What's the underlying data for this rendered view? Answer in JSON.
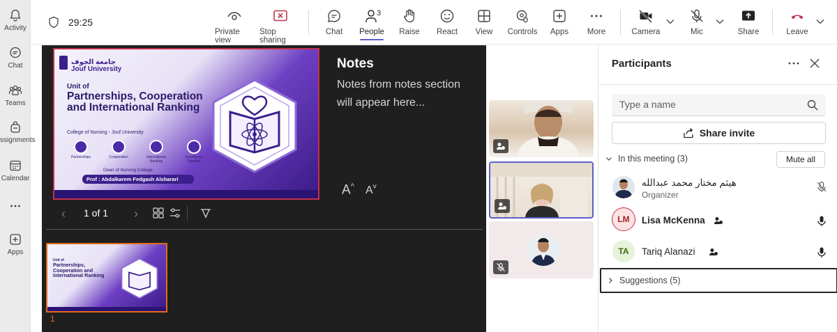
{
  "rail": {
    "items": [
      {
        "label": "Activity",
        "icon": "bell-icon"
      },
      {
        "label": "Chat",
        "icon": "chat-icon"
      },
      {
        "label": "Teams",
        "icon": "teams-icon"
      },
      {
        "label": "Assignments",
        "icon": "backpack-icon"
      },
      {
        "label": "Calendar",
        "icon": "calendar-icon"
      },
      {
        "label": "",
        "icon": "more-icon"
      },
      {
        "label": "Apps",
        "icon": "add-app-icon"
      }
    ]
  },
  "toolbar": {
    "timer": "29:25",
    "private_view": "Private view",
    "stop_sharing": "Stop sharing",
    "chat": "Chat",
    "people": "People",
    "people_count": "3",
    "raise": "Raise",
    "react": "React",
    "view": "View",
    "controls": "Controls",
    "apps": "Apps",
    "more": "More",
    "camera": "Camera",
    "mic": "Mic",
    "share": "Share",
    "leave": "Leave",
    "accent_color": "#5b5fc7",
    "alert_color": "#c4314b"
  },
  "stage": {
    "notes_title": "Notes",
    "notes_body": "Notes from notes section will appear here...",
    "font_increase": "A",
    "font_decrease": "A",
    "slide_count": "1 of 1",
    "thumb_number": "1",
    "slide": {
      "logo_text": "جامعة الجوف\nJouf University",
      "unit": "Unit of",
      "heading": "Partnerships, Cooperation and International Ranking",
      "college": "College of Nursing - Jouf University",
      "icons": [
        "Partnerships",
        "Cooperation",
        "International Ranking",
        "Excellence Together"
      ],
      "dean": "Dean of Nursing College",
      "prof": "Prof : Abdalkarem Fedgash Alsharari"
    }
  },
  "panel": {
    "title": "Participants",
    "search_placeholder": "Type a name",
    "share_invite": "Share invite",
    "section_label": "In this meeting (3)",
    "mute_all": "Mute all",
    "suggestions": "Suggestions (5)",
    "participants": [
      {
        "name": "هيثم مختار محمد عبدالله",
        "role": "Organizer",
        "initials": "",
        "mic": "muted"
      },
      {
        "name": "Lisa McKenna",
        "role": "",
        "initials": "LM",
        "mic": "on"
      },
      {
        "name": "Tariq Alanazi",
        "role": "",
        "initials": "TA",
        "mic": "on"
      }
    ]
  }
}
